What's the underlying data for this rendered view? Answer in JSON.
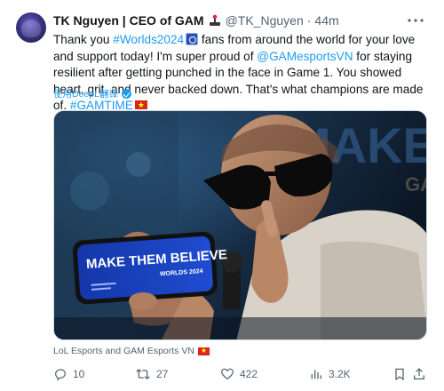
{
  "tweet": {
    "author_name": "TK Nguyen | CEO of GAM",
    "handle": "@TK_Nguyen",
    "separator": "·",
    "time": "44m",
    "text": {
      "p1": "Thank you ",
      "tag_worlds": "#Worlds2024",
      "p2": " fans from around the world for your love and support today! I'm super proud of ",
      "mention": "@GAMesportsVN",
      "p3": " for staying resilient after getting punched in the face in Game 1. You showed heart, grit, and never backed down. That's what champions are made of. ",
      "tag_gamtime": "#GAMTIME"
    },
    "translate_label": "使用DeepL翻译",
    "media": {
      "phone_line1": "MAKE THEM BELIEVE",
      "phone_line2": "WORLDS 2024",
      "bg_text": "MAKE T",
      "jersey_text": "GA"
    },
    "caption": "LoL Esports and GAM Esports VN",
    "actions": {
      "replies": "10",
      "retweets": "27",
      "likes": "422",
      "views": "3.2K"
    }
  },
  "colors": {
    "link": "#1d9bf0",
    "muted": "#536471",
    "text": "#0f1419",
    "flag_red": "#da251d",
    "flag_star": "#ffff00"
  },
  "icons": {
    "more": "more-dots-icon",
    "reply": "reply-icon",
    "retweet": "retweet-icon",
    "like": "heart-icon",
    "views": "views-chart-icon",
    "bookmark": "bookmark-icon",
    "share": "share-icon",
    "badge": "joystick-badge-icon",
    "translate": "translate-check-icon"
  }
}
